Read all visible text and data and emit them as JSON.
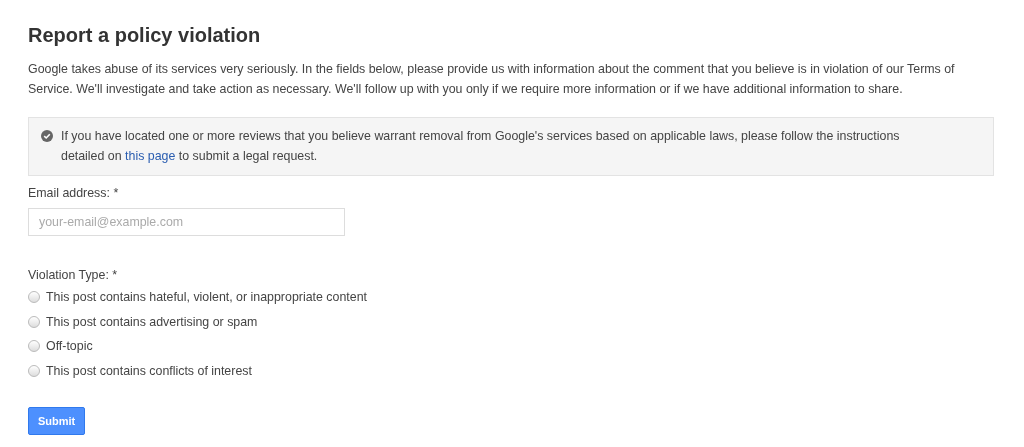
{
  "title": "Report a policy violation",
  "intro": "Google takes abuse of its services very seriously. In the fields below, please provide us with information about the comment that you believe is in violation of our Terms of Service. We'll investigate and take action as necessary. We'll follow up with you only if we require more information or if we have additional information to share.",
  "notice": {
    "before": "If you have located one or more reviews that you believe warrant removal from Google's services based on applicable laws, please follow the instructions detailed on",
    "link": "this page",
    "after": "to submit a legal request."
  },
  "email": {
    "label": "Email address: *",
    "placeholder": "your-email@example.com"
  },
  "violation": {
    "label": "Violation Type: *",
    "options": [
      {
        "label": "This post contains hateful, violent, or inappropriate content",
        "selected": false
      },
      {
        "label": "This post contains advertising or spam",
        "selected": false
      },
      {
        "label": "Off-topic",
        "selected": false
      },
      {
        "label": "This post contains conflicts of interest",
        "selected": false
      }
    ]
  },
  "submit": "Submit"
}
